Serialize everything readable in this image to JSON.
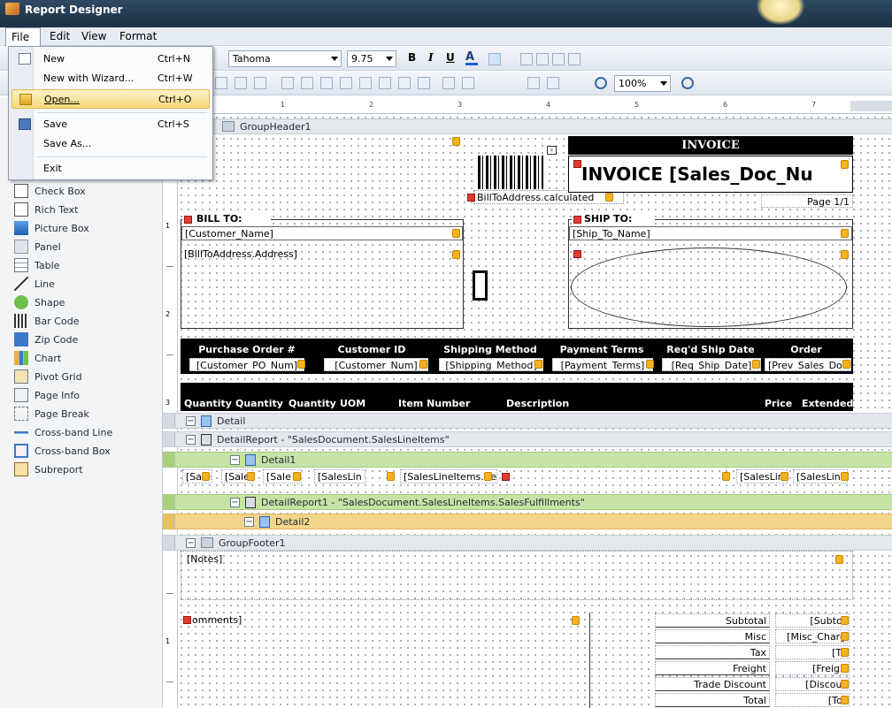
{
  "window": {
    "title": "Report Designer"
  },
  "menubar": {
    "items": [
      "File",
      "Edit",
      "View",
      "Format"
    ]
  },
  "file_menu": {
    "items": [
      {
        "label": "New",
        "shortcut": "Ctrl+N"
      },
      {
        "label": "New with Wizard...",
        "shortcut": "Ctrl+W"
      },
      {
        "label": "Open...",
        "shortcut": "Ctrl+O"
      },
      {
        "label": "Save",
        "shortcut": "Ctrl+S"
      },
      {
        "label": "Save As...",
        "shortcut": ""
      },
      {
        "label": "Exit",
        "shortcut": ""
      }
    ],
    "highlighted": "Open..."
  },
  "toolbar": {
    "font_name": "Tahoma",
    "font_size": "9.75",
    "bold": "B",
    "italic": "I",
    "underline": "U",
    "zoom": "100%"
  },
  "ruler": {
    "marks": [
      "1",
      "2",
      "3",
      "4",
      "5",
      "6",
      "7"
    ]
  },
  "toolbox": {
    "items": [
      "Check Box",
      "Rich Text",
      "Picture Box",
      "Panel",
      "Table",
      "Line",
      "Shape",
      "Bar Code",
      "Zip Code",
      "Chart",
      "Pivot Grid",
      "Page Info",
      "Page Break",
      "Cross-band Line",
      "Cross-band Box",
      "Subreport"
    ]
  },
  "vruler": {
    "labels": [
      "1",
      "2",
      "3",
      "1"
    ]
  },
  "bands": {
    "group_header": "GroupHeader1",
    "detail": "Detail",
    "detail_report": "DetailReport - \"SalesDocument.SalesLineItems\"",
    "detail1": "Detail1",
    "detail_report1": "DetailReport1 - \"SalesDocument.SalesLineItems.SalesFulfillments\"",
    "detail2": "Detail2",
    "group_footer": "GroupFooter1"
  },
  "header": {
    "address_field": "ess]",
    "invoice_title": "INVOICE",
    "invoice_field": "INVOICE  [Sales_Doc_Nu",
    "barcode_caption": "BillToAddress.calculated",
    "page_label": "Page 1/1",
    "bill_to": "BILL TO:",
    "customer_name": "[Customer_Name]",
    "bill_address": "[BillToAddress.Address]",
    "ship_to": "SHIP TO:",
    "ship_name": "[Ship_To_Name]"
  },
  "order_table": {
    "headers": [
      "Purchase Order #",
      "Customer ID",
      "Shipping Method",
      "Payment Terms",
      "Req'd Ship Date",
      "Order"
    ],
    "fields": [
      "[Customer_PO_Num]",
      "[Customer_Num]",
      "[Shipping_Method]",
      "[Payment_Terms]",
      "[Req_Ship_Date]",
      "[Prev_Sales_Do"
    ]
  },
  "line_header": {
    "columns": [
      "Quantity",
      "Quantity",
      "Quantity",
      "UOM",
      "Item Number",
      "Description",
      "Price",
      "Extended"
    ]
  },
  "detail1_fields": [
    "[SalesL",
    "[SalesL",
    "[Sale",
    "[SalesLin",
    "[SalesLineItems.Iter",
    "[SalesLin",
    "[SalesLin"
  ],
  "footer": {
    "notes": "[Notes]",
    "comments": "omments]",
    "totals_labels": [
      "Subtotal",
      "Misc",
      "Tax",
      "Freight",
      "Trade Discount",
      "Total"
    ],
    "totals_fields": [
      "[Subtot",
      "[Misc_Charg",
      "[Ta",
      "[Freigh",
      "[Discour",
      "[Tot"
    ]
  }
}
